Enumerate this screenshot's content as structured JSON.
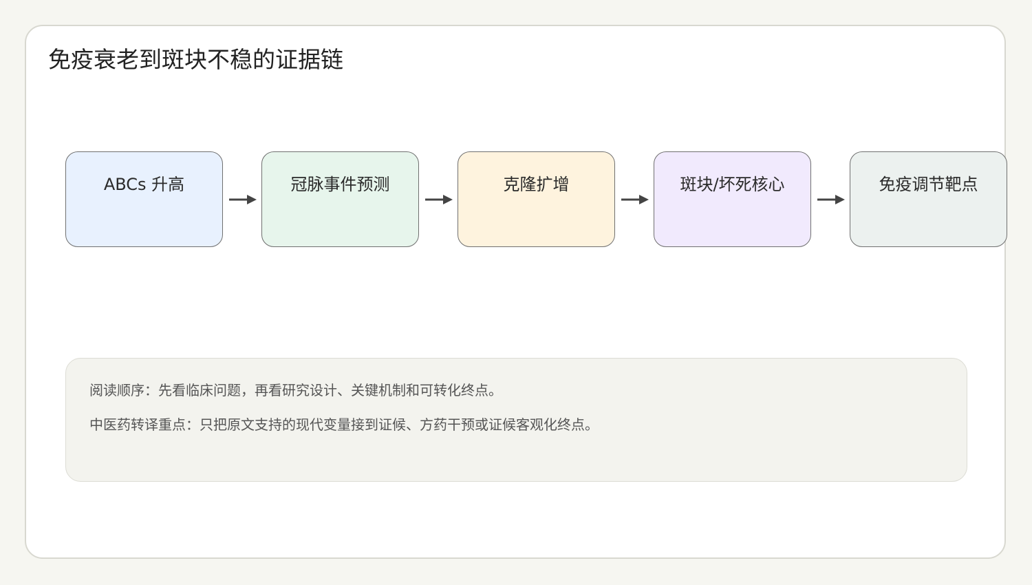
{
  "title": "免疫衰老到斑块不稳的证据链",
  "steps": [
    {
      "label": "ABCs 升高",
      "color": "#e8f1fe"
    },
    {
      "label": "冠脉事件预测",
      "color": "#e7f5ec"
    },
    {
      "label": "克隆扩增",
      "color": "#fef3de"
    },
    {
      "label": "斑块/坏死核心",
      "color": "#f1eafd"
    },
    {
      "label": "免疫调节靶点",
      "color": "#ecf1ef"
    }
  ],
  "notes": [
    "阅读顺序：先看临床问题，再看研究设计、关键机制和可转化终点。",
    "中医药转译重点：只把原文支持的现代变量接到证候、方药干预或证候客观化终点。"
  ],
  "colors": {
    "background": "#f6f6f1",
    "card": "#ffffff",
    "node_border": "#6f6f6f",
    "arrow": "#444444",
    "notes_bg": "#f3f3ee"
  }
}
